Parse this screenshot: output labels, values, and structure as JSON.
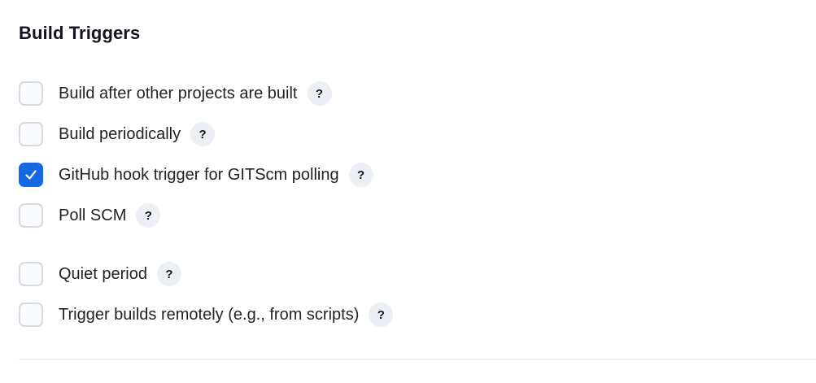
{
  "section": {
    "title": "Build Triggers"
  },
  "options": [
    {
      "label": "Build after other projects are built",
      "checked": false,
      "help": "?"
    },
    {
      "label": "Build periodically",
      "checked": false,
      "help": "?"
    },
    {
      "label": "GitHub hook trigger for GITScm polling",
      "checked": true,
      "help": "?"
    },
    {
      "label": "Poll SCM",
      "checked": false,
      "help": "?"
    },
    {
      "label": "Quiet period",
      "checked": false,
      "help": "?"
    },
    {
      "label": "Trigger builds remotely (e.g., from scripts)",
      "checked": false,
      "help": "?"
    }
  ],
  "colors": {
    "accent": "#1369e0",
    "checkbox_border": "#d6dbe3",
    "help_bg": "#eceff3"
  }
}
